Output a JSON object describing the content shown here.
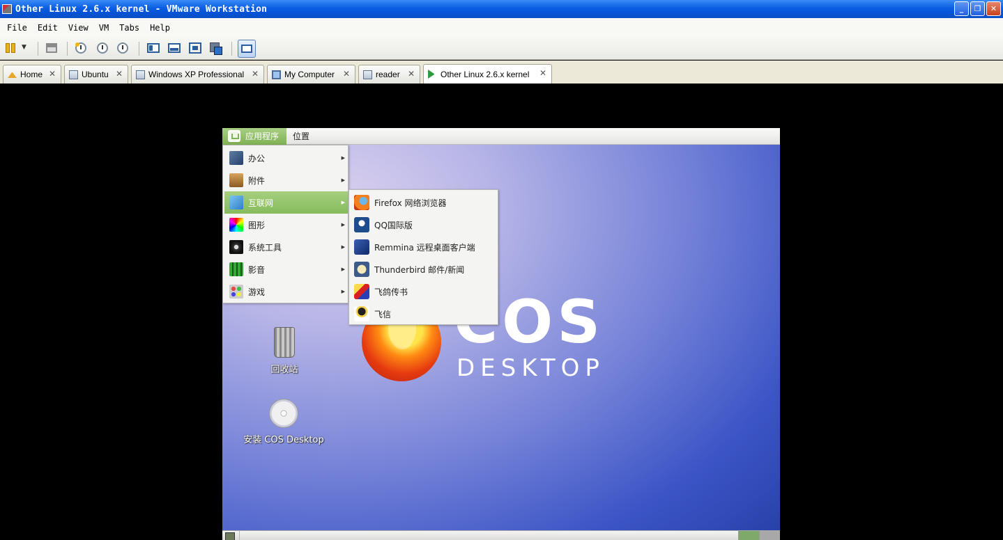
{
  "window": {
    "title": "Other Linux 2.6.x kernel - VMware Workstation",
    "minimize": "_",
    "restore": "❐",
    "close": "✕"
  },
  "menubar": [
    "File",
    "Edit",
    "View",
    "VM",
    "Tabs",
    "Help"
  ],
  "tabs": [
    {
      "label": "Home",
      "close": "✕"
    },
    {
      "label": "Ubuntu",
      "close": "✕"
    },
    {
      "label": "Windows XP Professional",
      "close": "✕"
    },
    {
      "label": "My Computer",
      "close": "✕"
    },
    {
      "label": "reader",
      "close": "✕"
    },
    {
      "label": "Other Linux 2.6.x kernel",
      "close": "✕"
    }
  ],
  "guest": {
    "panel": {
      "applications": "应用程序",
      "places": "位置"
    },
    "main_menu": [
      {
        "label": "办公",
        "icon": "office-icon"
      },
      {
        "label": "附件",
        "icon": "accessories-icon"
      },
      {
        "label": "互联网",
        "icon": "internet-icon"
      },
      {
        "label": "图形",
        "icon": "graphics-icon"
      },
      {
        "label": "系统工具",
        "icon": "system-tools-icon"
      },
      {
        "label": "影音",
        "icon": "multimedia-icon"
      },
      {
        "label": "游戏",
        "icon": "games-icon"
      }
    ],
    "submenu_arrow": "▶",
    "internet_menu": [
      {
        "label": "Firefox 网络浏览器",
        "icon": "firefox-icon"
      },
      {
        "label": "QQ国际版",
        "icon": "qq-icon"
      },
      {
        "label": "Remmina 远程桌面客户端",
        "icon": "remmina-icon"
      },
      {
        "label": "Thunderbird 邮件/新闻",
        "icon": "thunderbird-icon"
      },
      {
        "label": "飞鸽传书",
        "icon": "feige-icon"
      },
      {
        "label": "飞信",
        "icon": "fetion-icon"
      }
    ],
    "desktop_icons": [
      {
        "label": "回收站",
        "icon": "trash-icon"
      },
      {
        "label": "安装 COS Desktop",
        "icon": "cd-install-icon"
      }
    ],
    "logo": {
      "cos": "COS",
      "desktop": "DESKTOP"
    }
  }
}
